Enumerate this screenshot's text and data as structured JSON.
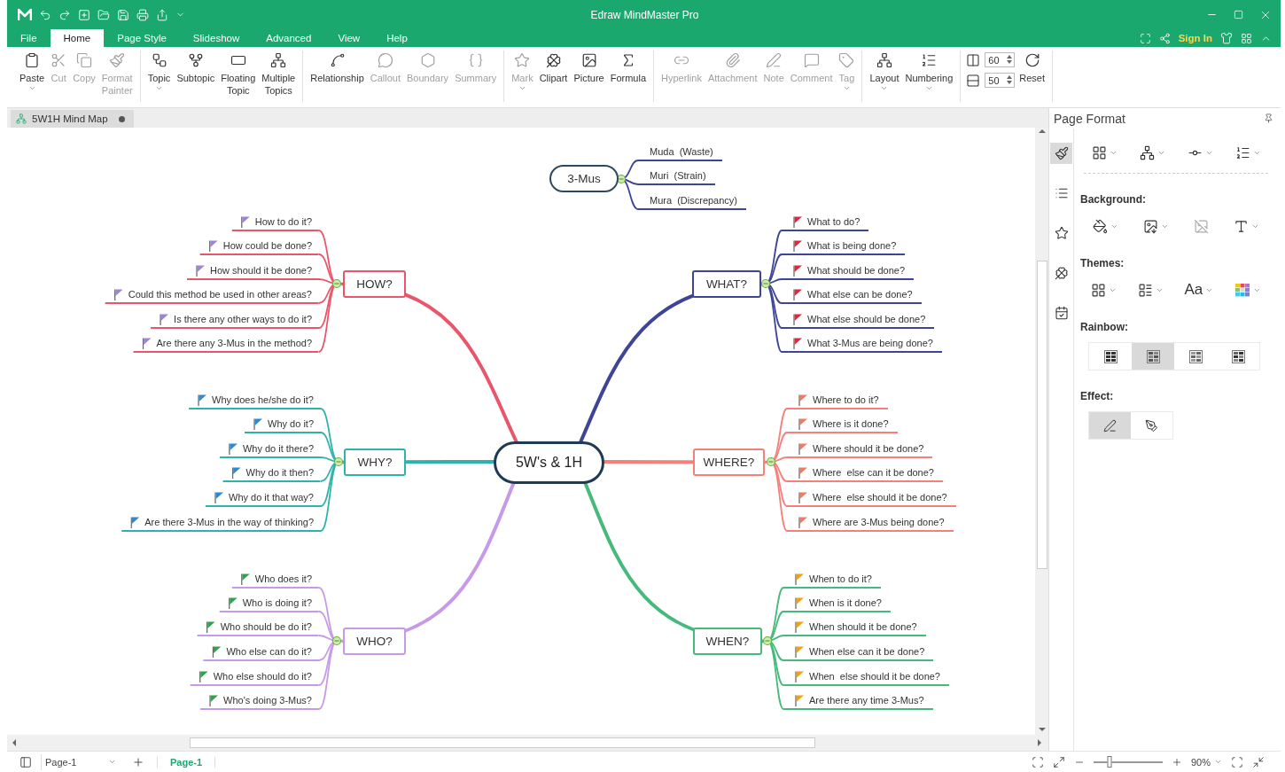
{
  "window": {
    "title": "Edraw MindMaster Pro"
  },
  "menu_tabs": [
    {
      "label": "File",
      "selected": false
    },
    {
      "label": "Home",
      "selected": true
    },
    {
      "label": "Page Style",
      "selected": false
    },
    {
      "label": "Slideshow",
      "selected": false
    },
    {
      "label": "Advanced",
      "selected": false
    },
    {
      "label": "View",
      "selected": false
    },
    {
      "label": "Help",
      "selected": false
    }
  ],
  "sign_in": "Sign In",
  "ribbon": [
    {
      "buttons": [
        {
          "label": "Paste",
          "disabled": false,
          "dropdown": true
        },
        {
          "label": "Cut",
          "disabled": true,
          "dropdown": false
        },
        {
          "label": "Copy",
          "disabled": true,
          "dropdown": false
        },
        {
          "label": "Format\nPainter",
          "disabled": true,
          "dropdown": false
        }
      ]
    },
    {
      "buttons": [
        {
          "label": "Topic",
          "disabled": false,
          "dropdown": true
        },
        {
          "label": "Subtopic",
          "disabled": false,
          "dropdown": false
        },
        {
          "label": "Floating\nTopic",
          "disabled": false,
          "dropdown": false
        },
        {
          "label": "Multiple\nTopics",
          "disabled": false,
          "dropdown": false
        }
      ]
    },
    {
      "buttons": [
        {
          "label": "Relationship",
          "disabled": false,
          "dropdown": false
        },
        {
          "label": "Callout",
          "disabled": true,
          "dropdown": false
        },
        {
          "label": "Boundary",
          "disabled": true,
          "dropdown": false
        },
        {
          "label": "Summary",
          "disabled": true,
          "dropdown": false
        }
      ]
    },
    {
      "buttons": [
        {
          "label": "Mark",
          "disabled": true,
          "dropdown": true
        },
        {
          "label": "Clipart",
          "disabled": false,
          "dropdown": false
        },
        {
          "label": "Picture",
          "disabled": false,
          "dropdown": false
        },
        {
          "label": "Formula",
          "disabled": false,
          "dropdown": false
        }
      ]
    },
    {
      "buttons": [
        {
          "label": "Hyperlink",
          "disabled": true,
          "dropdown": false
        },
        {
          "label": "Attachment",
          "disabled": true,
          "dropdown": false
        },
        {
          "label": "Note",
          "disabled": true,
          "dropdown": false
        },
        {
          "label": "Comment",
          "disabled": true,
          "dropdown": false
        },
        {
          "label": "Tag",
          "disabled": true,
          "dropdown": true
        }
      ]
    },
    {
      "buttons": [
        {
          "label": "Layout",
          "disabled": false,
          "dropdown": true
        },
        {
          "label": "Numbering",
          "disabled": false,
          "dropdown": true
        }
      ]
    }
  ],
  "spacing_fields": [
    {
      "value": "60"
    },
    {
      "value": "50"
    }
  ],
  "reset_button": "Reset",
  "document_tabs": [
    {
      "label": "5W1H Mind Map",
      "selected": true
    }
  ],
  "mind_map": {
    "central_topic": "5W's & 1H",
    "floating_topic": {
      "label": "3-Mus",
      "children": [
        "Muda  (Waste)",
        "Muri  (Strain)",
        "Mura  (Discrepancy)"
      ]
    },
    "branches": [
      {
        "label": "HOW?",
        "color": "#e9566b",
        "flag": {
          "color": "#9d84d6"
        },
        "children": [
          "How to do it?",
          "How could be done?",
          "How should it be done?",
          "Could this method be used in other areas?",
          "Is there any other ways to do it?",
          "Are there any 3-Mus in the method?"
        ]
      },
      {
        "label": "WHAT?",
        "color": "#3e4596",
        "flag": {
          "color": "#e0283a"
        },
        "children": [
          "What to do?",
          "What is being done?",
          "What should be done?",
          "What else can be done?",
          "What else should be done?",
          "What 3-Mus are being done?"
        ]
      },
      {
        "label": "WHY?",
        "color": "#2fb2aa",
        "flag": {
          "color": "#2b8ad8"
        },
        "children": [
          "Why does he/she do it?",
          "Why do it?",
          "Why do it there?",
          "Why do it then?",
          "Why do it that way?",
          "Are there 3-Mus in the way of thinking?"
        ]
      },
      {
        "label": "WHERE?",
        "color": "#f5807a",
        "flag": {
          "color": "#f27a63"
        },
        "children": [
          "Where to do it?",
          "Where is it done?",
          "Where should it be done?",
          "Where  else can it be done?",
          "Where  else should it be done?",
          "Where are 3-Mus being done?"
        ]
      },
      {
        "label": "WHO?",
        "color": "#c69ae6",
        "flag": {
          "color": "#2ea24c"
        },
        "children": [
          "Who does it?",
          "Who is doing it?",
          "Who should be do it?",
          "Who else can do it?",
          "Who else should do it?",
          "Who's doing 3-Mus?"
        ]
      },
      {
        "label": "WHEN?",
        "color": "#46b97c",
        "flag": {
          "color": "#f4a011"
        },
        "children": [
          "When to do it?",
          "When is it done?",
          "When should it be done?",
          "When else can it be done?",
          "When  else should it be done?",
          "Are there any time 3-Mus?"
        ]
      }
    ]
  },
  "panel": {
    "title": "Page Format",
    "side_tabs": [
      {
        "selected": true
      },
      {
        "selected": false
      },
      {
        "selected": false
      },
      {
        "selected": false
      },
      {
        "selected": false
      }
    ],
    "background_title": "Background:",
    "themes_title": "Themes:",
    "font_button": "Aa",
    "rainbow_title": "Rainbow:",
    "rainbow_options": [
      {
        "selected": false
      },
      {
        "selected": true
      },
      {
        "selected": false
      },
      {
        "selected": false
      }
    ],
    "effect_title": "Effect:",
    "effect_options": [
      {
        "selected": true
      },
      {
        "selected": false
      }
    ]
  },
  "status_bar": {
    "page_select": "Page-1",
    "page_tab": "Page-1",
    "zoom_slider": {
      "level": 0.23
    },
    "zoom": "90%"
  }
}
